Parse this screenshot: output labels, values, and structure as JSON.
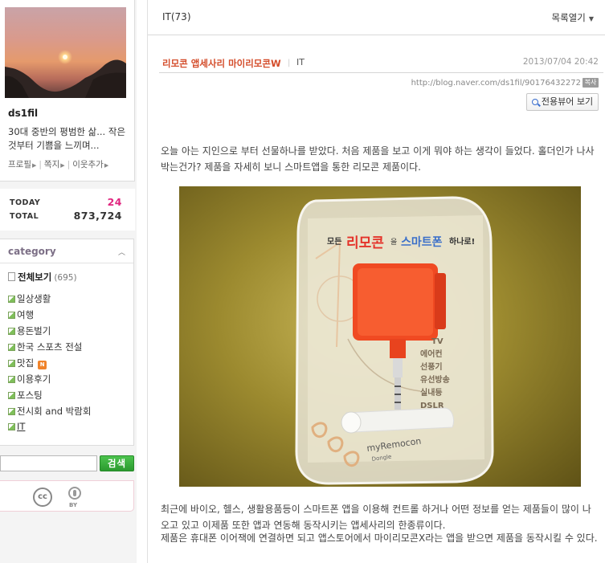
{
  "sidebar": {
    "profile": {
      "name": "ds1fil",
      "description": "30대 중반의 평범한 삶... 작은 것부터 기쁨을 느끼며...",
      "links": [
        "프로필",
        "쪽지",
        "이웃추가"
      ]
    },
    "visits": {
      "today_label": "TODAY",
      "today_value": "24",
      "total_label": "TOTAL",
      "total_value": "873,724"
    },
    "category": {
      "title": "category",
      "all_label": "전체보기",
      "all_count": "(695)",
      "items": [
        {
          "label": "일상생활"
        },
        {
          "label": "여행"
        },
        {
          "label": "용돈벌기"
        },
        {
          "label": "한국 스포츠 전설"
        },
        {
          "label": "맛집",
          "badge": "N"
        },
        {
          "label": "이용후기"
        },
        {
          "label": "포스팅"
        },
        {
          "label": "전시회 and 박람회"
        },
        {
          "label": "IT"
        }
      ]
    },
    "search": {
      "value": "",
      "button_label": "검색"
    },
    "license": {
      "cc_label": "cc",
      "by_label": "BY"
    }
  },
  "main": {
    "list_header": {
      "title": "IT(73)",
      "toggle_label": "목록열기"
    },
    "post": {
      "title": "리모콘 앱세사리 마이리모콘W",
      "category": "IT",
      "date": "2013/07/04 20:42",
      "url": "http://blog.naver.com/ds1fil/90176432272",
      "copy_badge": "복사",
      "viewer_button": "전용뷰어 보기",
      "paragraphs": [
        "오늘 아는 지인으로 부터 선물하나를 받았다. 처음 제품을 보고 이게 뭐야 하는 생각이 들었다. 홀더인가 나사 박는건가? 제품을 자세히 보니 스마트앱을 통한 리모콘 제품이다.",
        "최근에 바이오, 헬스, 생활용품등이 스마트폰 앱을 이용해 컨트롤 하거나 어떤 정보를 얻는 제품들이 많이 나오고 있고 이제품 또한 앱과 연동해 동작시키는 앱세사리의 한종류이다.",
        "제품은 휴대폰 이어잭에 연결하면 되고 앱스토어에서 마이리모콘X라는 앱을 받으면 제품을 동작시킬 수 있다."
      ],
      "photo": {
        "banner_prefix": "모든",
        "banner_red": "리모콘",
        "banner_mid": "을",
        "banner_blue": "스마트폰",
        "banner_suffix": "하나로!",
        "feature_list": [
          "TV",
          "에어컨",
          "선풍기",
          "유선방송",
          "실내등",
          "DSLR"
        ],
        "brand": "myRemocon",
        "brand_sub": "Dongle"
      }
    }
  }
}
